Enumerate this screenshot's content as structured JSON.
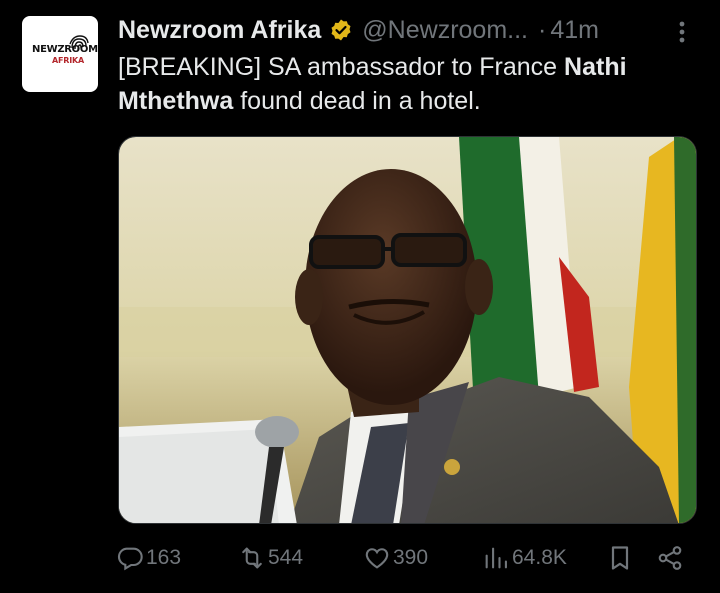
{
  "tweet": {
    "author_name": "Newzroom Afrika",
    "handle": "@Newzroom...",
    "separator": "·",
    "time": "41m",
    "text_before": "[BREAKING] SA ambassador to France ",
    "text_bold": "Nathi Mthethwa",
    "text_after": " found dead in a hotel.",
    "avatar_logo_top": "NEWZROOM",
    "avatar_logo_bottom": "AFRIKA",
    "verified_color": "#e2b719"
  },
  "actions": {
    "replies": "163",
    "reposts": "544",
    "likes": "390",
    "views": "64.8K"
  },
  "icons": [
    "verified-badge-icon",
    "more-icon",
    "reply-icon",
    "repost-icon",
    "like-icon",
    "views-icon",
    "bookmark-icon",
    "share-icon"
  ]
}
